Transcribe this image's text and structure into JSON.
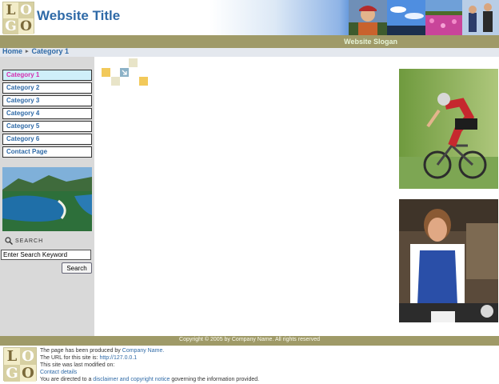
{
  "header": {
    "logo_letters": [
      "L",
      "O",
      "G",
      "O"
    ],
    "title": "Website Title",
    "slogan": "Website Slogan"
  },
  "breadcrumb": {
    "home": "Home",
    "separator": "▸",
    "current": "Category 1"
  },
  "sidebar": {
    "nav": [
      {
        "label": "Category 1",
        "active": true
      },
      {
        "label": "Category 2",
        "active": false
      },
      {
        "label": "Category 3",
        "active": false
      },
      {
        "label": "Category 4",
        "active": false
      },
      {
        "label": "Category 5",
        "active": false
      },
      {
        "label": "Category 6",
        "active": false
      },
      {
        "label": "Contact Page",
        "active": false
      }
    ],
    "search": {
      "label": "SEARCH",
      "input_value": "Enter Search Keyword",
      "button_label": "Search"
    }
  },
  "footer": {
    "copyright": "Copyright © 2005 by Company Name. All rights reserved",
    "line1_text": "The page has been produced by",
    "line1_link": "Company Name.",
    "line2_text": "The URL for this site is:",
    "line2_link": "http://127.0.0.1",
    "line3_text": "This site was last modified on:",
    "line4_link": "Contact details",
    "line5_text_a": "You are directed to a",
    "line5_link": "disclaimer and copyright notice",
    "line5_text_b": "governing the information provided."
  },
  "icons": {
    "search": "magnifier-icon",
    "arrow": "arrow-down-right-icon"
  },
  "colors": {
    "brand_blue": "#2f6aa7",
    "olive_bar": "#9f9a68",
    "active_nav": "#d62fb0"
  }
}
